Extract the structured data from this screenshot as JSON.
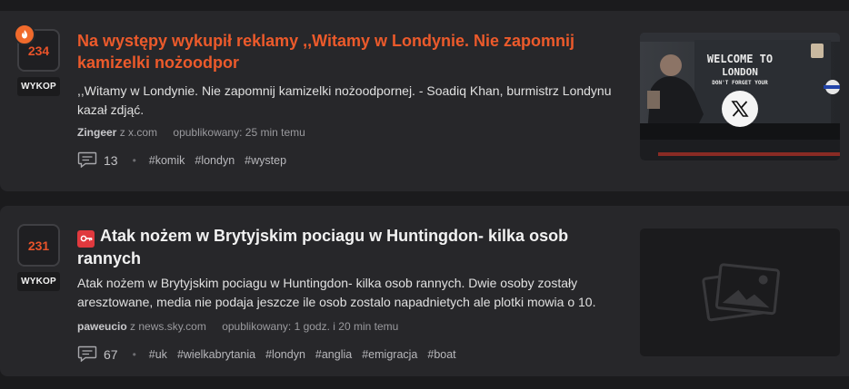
{
  "articles": [
    {
      "votes": "234",
      "vote_button": "WYKOP",
      "title": "Na występy wykupił reklamy ,,Witamy w Londynie. Nie zapomnij kamizelki nożoodpor",
      "description": ",,Witamy w Londynie. Nie zapomnij kamizelki nożoodpornej. - Soadiq Khan, burmistrz Londynu kazał zdjąć.",
      "author": "Zingeer",
      "source_prefix": "z",
      "source": "x.com",
      "published": "opublikowany: 25 min temu",
      "comments": "13",
      "tags": [
        "#komik",
        "#londyn",
        "#wystep"
      ],
      "thumbnail": {
        "sign_lines": [
          "WELCOME TO",
          "LONDON",
          "DON'T FORGET YOUR"
        ],
        "overlay_icon": "x-logo-icon"
      }
    },
    {
      "votes": "231",
      "vote_button": "WYKOP",
      "title": "Atak nożem w Brytyjskim pociagu w Huntingdon- kilka osob rannych",
      "description": "Atak nożem w Brytyjskim pociagu w Huntingdon- kilka osob rannych. Dwie osoby zostały aresztowane, media nie podaja jeszcze ile osob zostalo napadnietych ale plotki mowia o 10.",
      "author": "paweucio",
      "source_prefix": "z",
      "source": "news.sky.com",
      "published": "opublikowany: 1 godz. i 20 min temu",
      "comments": "67",
      "tags": [
        "#uk",
        "#wielkabrytania",
        "#londyn",
        "#anglia",
        "#emigracja",
        "#boat"
      ],
      "thumbnail": {
        "overlay_icon": "image-placeholder-icon"
      }
    }
  ],
  "colors": {
    "accent": "#ec5a2b",
    "card_bg": "#27272a",
    "page_bg": "#1b1b1d",
    "badge_red": "#e0393e"
  }
}
